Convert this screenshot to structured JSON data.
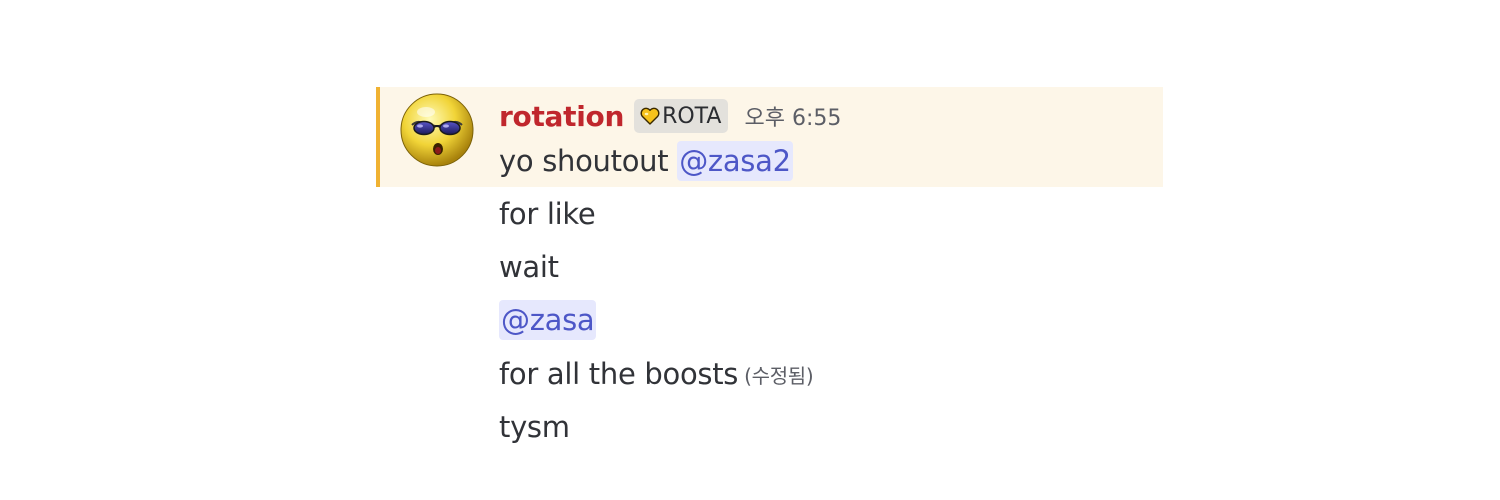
{
  "message": {
    "author": "rotation",
    "role_tag": "ROTA",
    "role_icon": "heart-icon",
    "timestamp": "오후 6:55",
    "lines": [
      {
        "text": "yo shoutout ",
        "mention": "@zasa2"
      },
      {
        "text": "for like"
      },
      {
        "text": "wait"
      },
      {
        "mention": "@zasa"
      },
      {
        "text": "for all the boosts",
        "edited": "(수정됨)"
      },
      {
        "text": "tysm"
      }
    ]
  },
  "colors": {
    "highlight_bg": "#fdf6e8",
    "highlight_border": "#f0b232",
    "username": "#c0272d",
    "mention_text": "#4d57c7",
    "mention_bg": "#e6e8fd"
  }
}
